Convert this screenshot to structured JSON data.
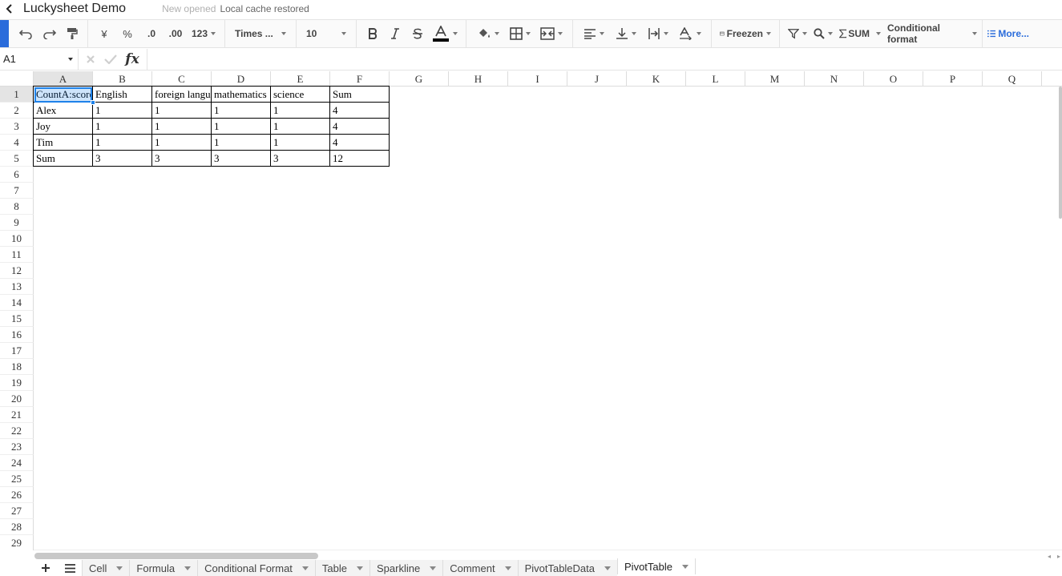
{
  "app": {
    "title": "Luckysheet Demo",
    "status_muted": "New opened",
    "status_text": "Local cache restored"
  },
  "toolbar": {
    "currency_label": "¥",
    "percent_label": "%",
    "decimal_decrease_label": ".0",
    "decimal_increase_label": ".00",
    "number_format_label": "123",
    "font_family": "Times ...",
    "font_size": "10",
    "freeze_label": "Freezen",
    "sum_label": "SUM",
    "conditional_format_label": "Conditional format",
    "more_label": "More..."
  },
  "formula_bar": {
    "namebox": "A1",
    "formula": ""
  },
  "grid": {
    "columns": [
      "A",
      "B",
      "C",
      "D",
      "E",
      "F",
      "G",
      "H",
      "I",
      "J",
      "K",
      "L",
      "M",
      "N",
      "O",
      "P",
      "Q"
    ],
    "rows": [
      "1",
      "2",
      "3",
      "4",
      "5",
      "6",
      "7",
      "8",
      "9",
      "10",
      "11",
      "12",
      "13",
      "14",
      "15",
      "16",
      "17",
      "18",
      "19",
      "20",
      "21",
      "22",
      "23",
      "24",
      "25",
      "26",
      "27",
      "28",
      "29"
    ],
    "data": [
      [
        "CountA:score",
        "English",
        "foreign language",
        "mathematics",
        "science",
        "Sum"
      ],
      [
        "Alex",
        "1",
        "1",
        "1",
        "1",
        "4"
      ],
      [
        "Joy",
        "1",
        "1",
        "1",
        "1",
        "4"
      ],
      [
        "Tim",
        "1",
        "1",
        "1",
        "1",
        "4"
      ],
      [
        "Sum",
        "3",
        "3",
        "3",
        "3",
        "12"
      ]
    ]
  },
  "sheets": {
    "tabs": [
      "Cell",
      "Formula",
      "Conditional Format",
      "Table",
      "Sparkline",
      "Comment",
      "PivotTableData"
    ],
    "active": "PivotTable"
  },
  "colors": {
    "accent": "#2a6cdb",
    "selection": "#1e82ea"
  }
}
